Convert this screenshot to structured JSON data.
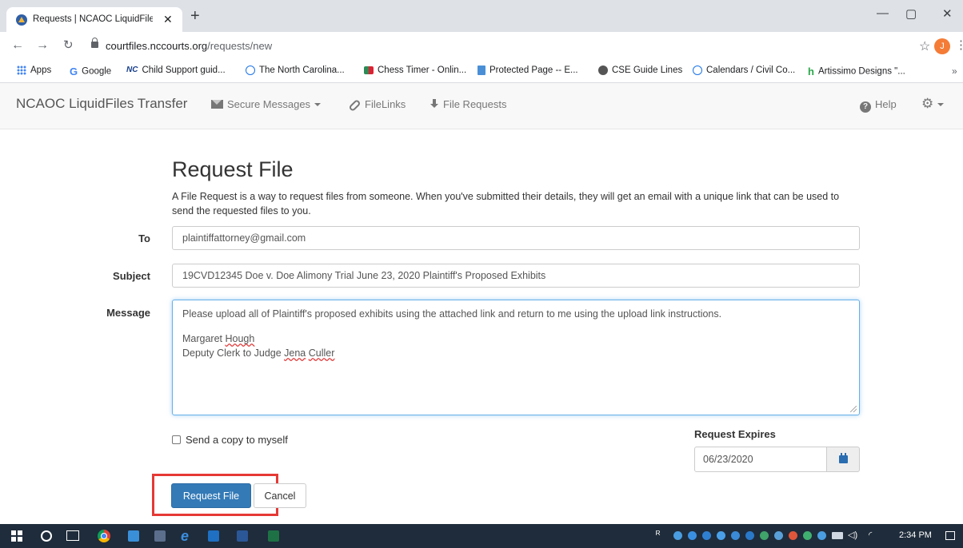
{
  "browser": {
    "tab_title": "Requests | NCAOC LiquidFiles Tra",
    "tab_close": "✕",
    "new_tab": "+",
    "window_minimize": "—",
    "window_restore": "▢",
    "window_close": "✕",
    "url_host": "courtfiles.nccourts.org",
    "url_path": "/requests/new",
    "profile_initial": "J"
  },
  "bookmarks": [
    {
      "label": "Apps",
      "icon": "apps-grid-icon"
    },
    {
      "label": "Google",
      "icon": "google-icon"
    },
    {
      "label": "Child Support guid...",
      "icon": "nc-icon"
    },
    {
      "label": "The North Carolina...",
      "icon": "circle-icon"
    },
    {
      "label": "Chess Timer - Onlin...",
      "icon": "chess-icon"
    },
    {
      "label": "Protected Page -- E...",
      "icon": "doc-icon"
    },
    {
      "label": "CSE Guide Lines",
      "icon": "cse-icon"
    },
    {
      "label": "Calendars / Civil Co...",
      "icon": "circle-icon"
    },
    {
      "label": "Artissimo Designs \"...",
      "icon": "h-icon"
    }
  ],
  "bookmarks_more": "»",
  "app": {
    "brand": "NCAOC LiquidFiles Transfer",
    "nav": {
      "secure_messages": "Secure Messages",
      "filelinks": "FileLinks",
      "file_requests": "File Requests",
      "help": "Help"
    }
  },
  "form": {
    "title": "Request File",
    "intro": "A File Request is a way to request files from someone. When you've submitted their details, they will get an email with a unique link that can be used to send the requested files to you.",
    "to_label": "To",
    "to_value": "plaintiffattorney@gmail.com",
    "subject_label": "Subject",
    "subject_value": "19CVD12345 Doe v. Doe Alimony Trial June 23, 2020 Plaintiff's Proposed Exhibits",
    "message_label": "Message",
    "message": {
      "line1": "Please upload all of Plaintiff's proposed exhibits using the attached link and return to me using the upload link instructions.",
      "sig_name_first": "Margaret ",
      "sig_name_last": "Hough",
      "sig_title_pre": "Deputy Clerk to Judge ",
      "sig_judge_first": "Jena",
      "sig_space": " ",
      "sig_judge_last": "Culler"
    },
    "send_copy_label": "Send a copy to myself",
    "send_copy_checked": false,
    "expires_label": "Request Expires",
    "expires_value": "06/23/2020",
    "submit_label": "Request File",
    "cancel_label": "Cancel"
  },
  "taskbar": {
    "clock": "2:34 PM"
  },
  "colors": {
    "primary_button": "#337ab7",
    "highlight_outline": "#e53935",
    "focus_border": "#66afe9",
    "taskbar": "#1f2c3b"
  }
}
